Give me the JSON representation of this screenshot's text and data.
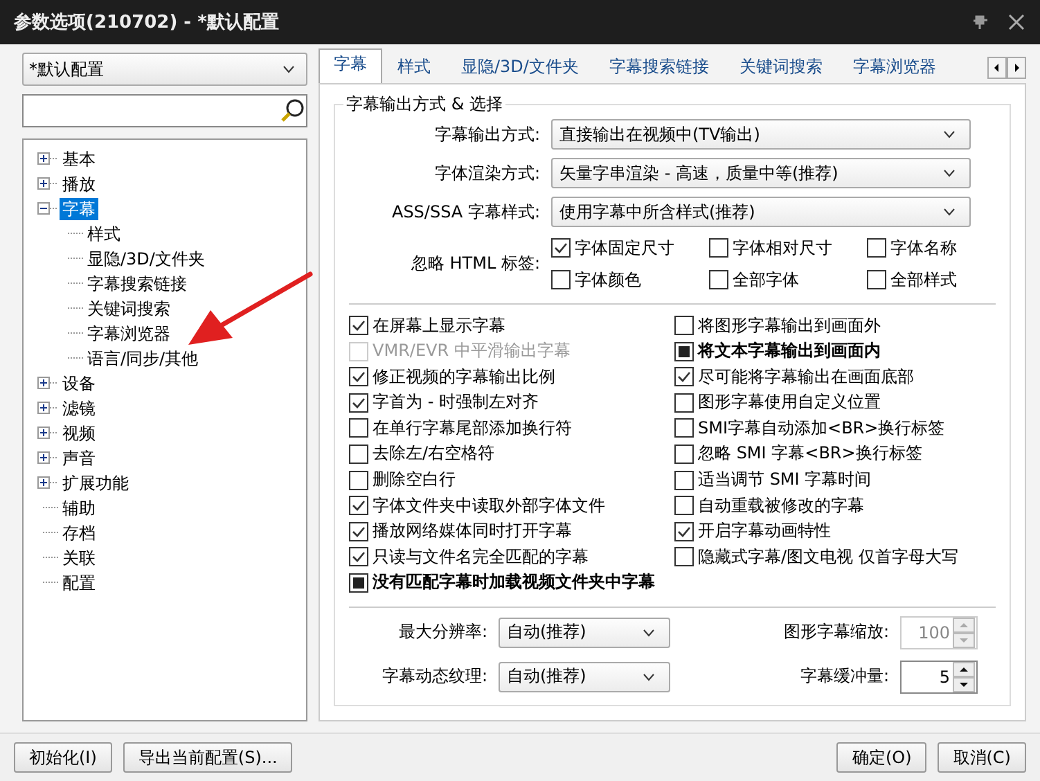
{
  "window": {
    "title": "参数选项(210702) - *默认配置"
  },
  "profile_select": {
    "value": "*默认配置"
  },
  "tree": [
    {
      "label": "基本",
      "kind": "folder",
      "expanded": false,
      "selected": false
    },
    {
      "label": "播放",
      "kind": "folder",
      "expanded": false,
      "selected": false
    },
    {
      "label": "字幕",
      "kind": "folder",
      "expanded": true,
      "selected": true,
      "children": [
        {
          "label": "样式",
          "kind": "leaf",
          "selected": false
        },
        {
          "label": "显隐/3D/文件夹",
          "kind": "leaf",
          "selected": false
        },
        {
          "label": "字幕搜索链接",
          "kind": "leaf",
          "selected": false
        },
        {
          "label": "关键词搜索",
          "kind": "leaf",
          "selected": false
        },
        {
          "label": "字幕浏览器",
          "kind": "leaf",
          "selected": false
        },
        {
          "label": "语言/同步/其他",
          "kind": "leaf",
          "selected": false
        }
      ]
    },
    {
      "label": "设备",
      "kind": "folder",
      "expanded": false,
      "selected": false
    },
    {
      "label": "滤镜",
      "kind": "folder",
      "expanded": false,
      "selected": false
    },
    {
      "label": "视频",
      "kind": "folder",
      "expanded": false,
      "selected": false
    },
    {
      "label": "声音",
      "kind": "folder",
      "expanded": false,
      "selected": false
    },
    {
      "label": "扩展功能",
      "kind": "folder",
      "expanded": false,
      "selected": false
    },
    {
      "label": "辅助",
      "kind": "leaf",
      "selected": false
    },
    {
      "label": "存档",
      "kind": "leaf",
      "selected": false
    },
    {
      "label": "关联",
      "kind": "leaf",
      "selected": false
    },
    {
      "label": "配置",
      "kind": "leaf",
      "selected": false
    }
  ],
  "tabs": [
    {
      "label": "字幕",
      "selected": true
    },
    {
      "label": "样式",
      "selected": false
    },
    {
      "label": "显隐/3D/文件夹",
      "selected": false
    },
    {
      "label": "字幕搜索链接",
      "selected": false
    },
    {
      "label": "关键词搜索",
      "selected": false
    },
    {
      "label": "字幕浏览器",
      "selected": false
    }
  ],
  "group_title": "字幕输出方式 & 选择",
  "selects": [
    {
      "label": "字幕输出方式:",
      "value": "直接输出在视频中(TV输出)"
    },
    {
      "label": "字体渲染方式:",
      "value": "矢量字串渲染 - 高速，质量中等(推荐)"
    },
    {
      "label": "ASS/SSA 字幕样式:",
      "value": "使用字幕中所含样式(推荐)"
    }
  ],
  "ignore_html": {
    "label": "忽略 HTML 标签:",
    "options": [
      {
        "label": "字体固定尺寸",
        "checked": true
      },
      {
        "label": "字体相对尺寸",
        "checked": false
      },
      {
        "label": "字体名称",
        "checked": false
      },
      {
        "label": "字体颜色",
        "checked": false
      },
      {
        "label": "全部字体",
        "checked": false
      },
      {
        "label": "全部样式",
        "checked": false
      }
    ]
  },
  "options": [
    {
      "label": "在屏幕上显示字幕",
      "checked": true,
      "indeterminate": false,
      "disabled": false
    },
    {
      "label": "将图形字幕输出到画面外",
      "checked": false,
      "indeterminate": false,
      "disabled": false
    },
    {
      "label": "VMR/EVR 中平滑输出字幕",
      "checked": false,
      "indeterminate": false,
      "disabled": true
    },
    {
      "label": "将文本字幕输出到画面内",
      "checked": false,
      "indeterminate": true,
      "disabled": false
    },
    {
      "label": "修正视频的字幕输出比例",
      "checked": true,
      "indeterminate": false,
      "disabled": false
    },
    {
      "label": "尽可能将字幕输出在画面底部",
      "checked": true,
      "indeterminate": false,
      "disabled": false
    },
    {
      "label": "字首为 - 时强制左对齐",
      "checked": true,
      "indeterminate": false,
      "disabled": false
    },
    {
      "label": "图形字幕使用自定义位置",
      "checked": false,
      "indeterminate": false,
      "disabled": false
    },
    {
      "label": "在单行字幕尾部添加换行符",
      "checked": false,
      "indeterminate": false,
      "disabled": false
    },
    {
      "label": "SMI字幕自动添加<BR>换行标签",
      "checked": false,
      "indeterminate": false,
      "disabled": false
    },
    {
      "label": "去除左/右空格符",
      "checked": false,
      "indeterminate": false,
      "disabled": false
    },
    {
      "label": "忽略 SMI 字幕<BR>换行标签",
      "checked": false,
      "indeterminate": false,
      "disabled": false
    },
    {
      "label": "删除空白行",
      "checked": false,
      "indeterminate": false,
      "disabled": false
    },
    {
      "label": "适当调节 SMI 字幕时间",
      "checked": false,
      "indeterminate": false,
      "disabled": false
    },
    {
      "label": "字体文件夹中读取外部字体文件",
      "checked": true,
      "indeterminate": false,
      "disabled": false
    },
    {
      "label": "自动重载被修改的字幕",
      "checked": false,
      "indeterminate": false,
      "disabled": false
    },
    {
      "label": "播放网络媒体同时打开字幕",
      "checked": true,
      "indeterminate": false,
      "disabled": false
    },
    {
      "label": "开启字幕动画特性",
      "checked": true,
      "indeterminate": false,
      "disabled": false
    },
    {
      "label": "只读与文件名完全匹配的字幕",
      "checked": true,
      "indeterminate": false,
      "disabled": false
    },
    {
      "label": "隐藏式字幕/图文电视 仅首字母大写",
      "checked": false,
      "indeterminate": false,
      "disabled": false
    },
    {
      "label": "没有匹配字幕时加载视频文件夹中字幕",
      "checked": false,
      "indeterminate": true,
      "disabled": false,
      "wide": true
    }
  ],
  "bottom_fields": [
    {
      "kind": "select",
      "label": "最大分辨率:",
      "value": "自动(推荐)"
    },
    {
      "kind": "spinner",
      "label": "图形字幕缩放:",
      "value": "100",
      "disabled": true
    },
    {
      "kind": "select",
      "label": "字幕动态纹理:",
      "value": "自动(推荐)"
    },
    {
      "kind": "spinner",
      "label": "字幕缓冲量:",
      "value": "5",
      "disabled": false
    }
  ],
  "buttons_left": [
    "初始化(I)",
    "导出当前配置(S)..."
  ],
  "buttons_right": [
    "确定(O)",
    "取消(C)"
  ]
}
